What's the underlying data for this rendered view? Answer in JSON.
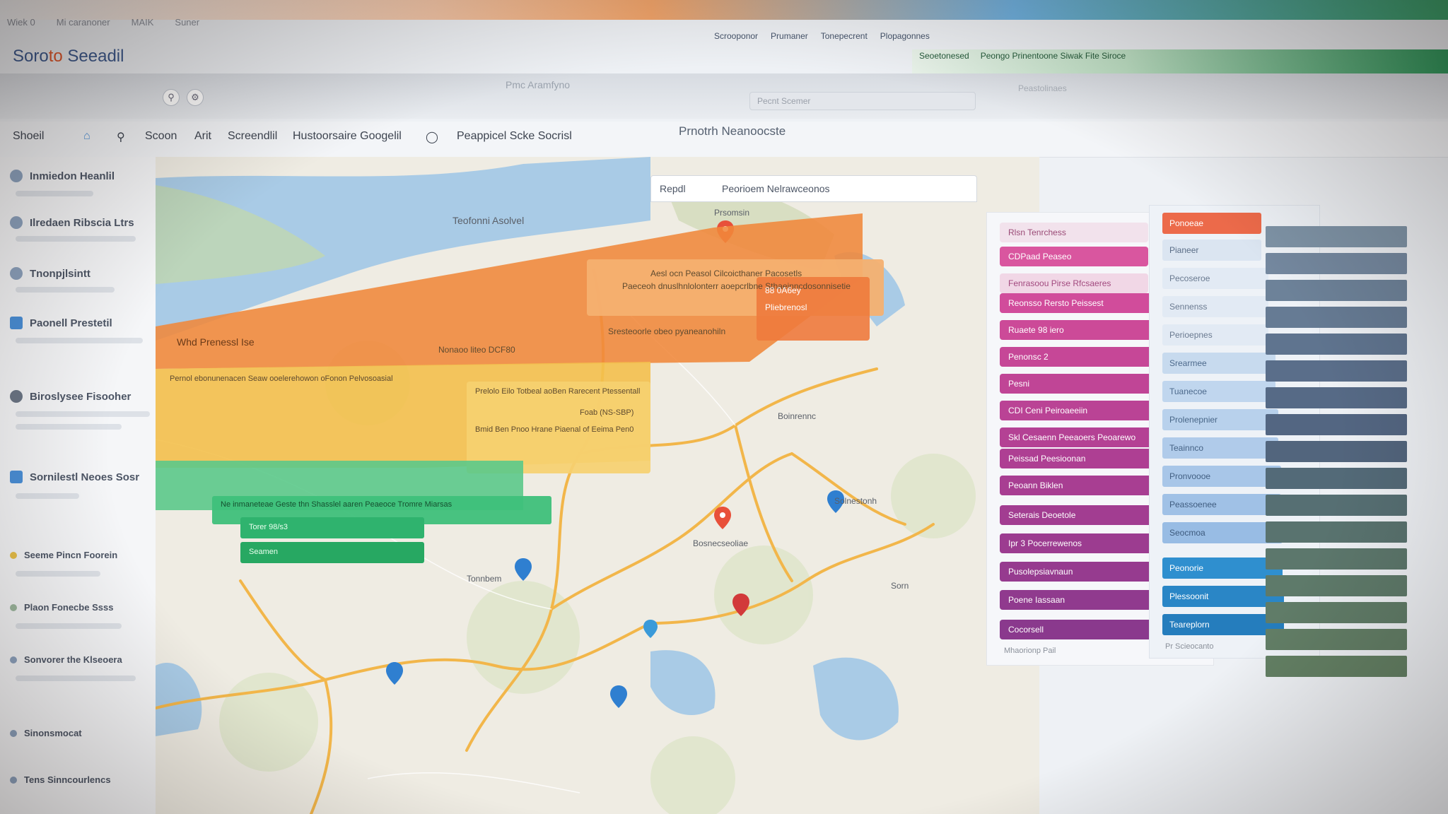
{
  "window": {
    "menu": [
      "Wiek 0",
      "Mi caranoner",
      "MAIK",
      "Suner"
    ],
    "app_title_a": "Soro",
    "app_title_b": "to",
    "app_title_c": " Seeadil",
    "top_links": [
      "Scrooponor",
      "Prumaner",
      "Tonepecrent",
      "Plopagonnes"
    ],
    "green_links": [
      "Seoetonesed",
      "Peongo Prinentoone Siwak Fite Siroce"
    ],
    "center_title": "Pmc Aramfyno",
    "search_placeholder": "Pecnt Scemer",
    "right_hint": "Peastolinaes"
  },
  "toolbar": {
    "items": [
      "Shoeil",
      "Scoon",
      "Arit",
      "Screendlil",
      "Hustoorsaire Googelil",
      "Peappicel Scke Socrisl"
    ],
    "map_tools_title": "Prnotrh Neanoocste",
    "map_tabs": [
      "Repdl",
      "Peorioem Nelrawceonos"
    ]
  },
  "sidebar": {
    "items": [
      {
        "label": "Inmiedon Heanlil",
        "icon": "circle-icon"
      },
      {
        "label": "Ilredaen Ribscia Ltrs",
        "icon": "circle-icon"
      },
      {
        "label": "Tnonpjlsintt",
        "icon": "circle-icon"
      },
      {
        "label": "Paonell Prestetil",
        "icon": "square-icon"
      },
      {
        "label": "Biroslysee Fisooher",
        "icon": "circle-icon"
      },
      {
        "label": "Sornilestl Neoes Sosr",
        "icon": "square-icon"
      },
      {
        "label": "Seeme Pincn Foorein",
        "icon": "circle-icon"
      },
      {
        "label": "Plaon Fonecbe Ssss",
        "icon": "circle-icon"
      },
      {
        "label": "Sonvorer the Klseoera",
        "icon": "circle-icon"
      },
      {
        "label": "Sinonsmocat",
        "icon": "circle-icon"
      },
      {
        "label": "Tens Sinncourlencs",
        "icon": "circle-icon"
      }
    ]
  },
  "map": {
    "labels": [
      "Teofonni Asolvel",
      "Prsomsin",
      "Boinrennc",
      "Solnestonh",
      "Sorn",
      "Tonnbem",
      "Bosnecseoliae"
    ],
    "overlays": {
      "orange_title": "Whd Prenessl Ise",
      "orange_card_a": "Aesl ocn Peasol Cilcoicthaner Pacosetls",
      "orange_card_b": "Paeceoh dnuslhnlolonterr aoepcrlbne Sthaeinncdosonnisetie",
      "orange_card_c": "Sresteoorle obeo pyaneanohiln",
      "orange_note": "Nonaoo liteo DCF80",
      "orange_val_a": "88 0A6ey",
      "orange_val_b": "Pliebrenosl",
      "yellow_title": "Pernol ebonunenacen Seaw ooelerehowon oFonon Pelvosoasial",
      "yellow_card_a": "Prelolo Eilo Totbeal aoBen Rarecent Ptessentall",
      "yellow_card_b": "Bmid Ben Pnoo Hrane Piaenal of Eeima Pen0",
      "yellow_val": "Foab (NS-SBP)",
      "green_title": "Ne inmaneteae Geste thn Shasslel aaren Peaeoce Tromre Miarsas",
      "green_row_a": "Torer 98/s3",
      "green_row_b": "Seamen"
    }
  },
  "panels": {
    "pink_header": "Rlsn Tenrchess",
    "pink_rows": [
      "CDPaad Peaseo",
      "Fenrasoou Pirse Rfcsaeres",
      "Reonsso Rersto Peissest",
      "Ruaete 98 iero",
      "Penonsc 2",
      "Pesni",
      "CDI Ceni Peiroaeeiin",
      "Skl Cesaenn Peeaoers Peoarewo",
      "Peissad Peesioonan",
      "Peoann Biklen",
      "Seterais Deoetole",
      "Ipr 3 Pocerrewenos",
      "Pusolepsiavnaun",
      "Poene Iassaan",
      "Cocorsell"
    ],
    "pink_footer": "Mhaorionp Pail",
    "blue_header": "Ponoeae",
    "blue_rows": [
      "Pianeer",
      "Pecoseroe",
      "Sennenss",
      "Perioepnes",
      "Srearmee",
      "Tuanecoe",
      "Prolenepnier",
      "Teainnco",
      "Pronvoooe",
      "Peassoenee",
      "Seocmoa",
      "Peonorie",
      "Plessoonit",
      "Teareplorn"
    ],
    "blue_footer": "Pr Scieocanto"
  },
  "colors": {
    "orange": "#f0873a",
    "yellow": "#f3c04c",
    "green": "#3ec07a",
    "pink": "#d04a9a",
    "purple": "#8a45a8",
    "blue": "#2f8fcf",
    "slate": "#5f7a8f"
  }
}
